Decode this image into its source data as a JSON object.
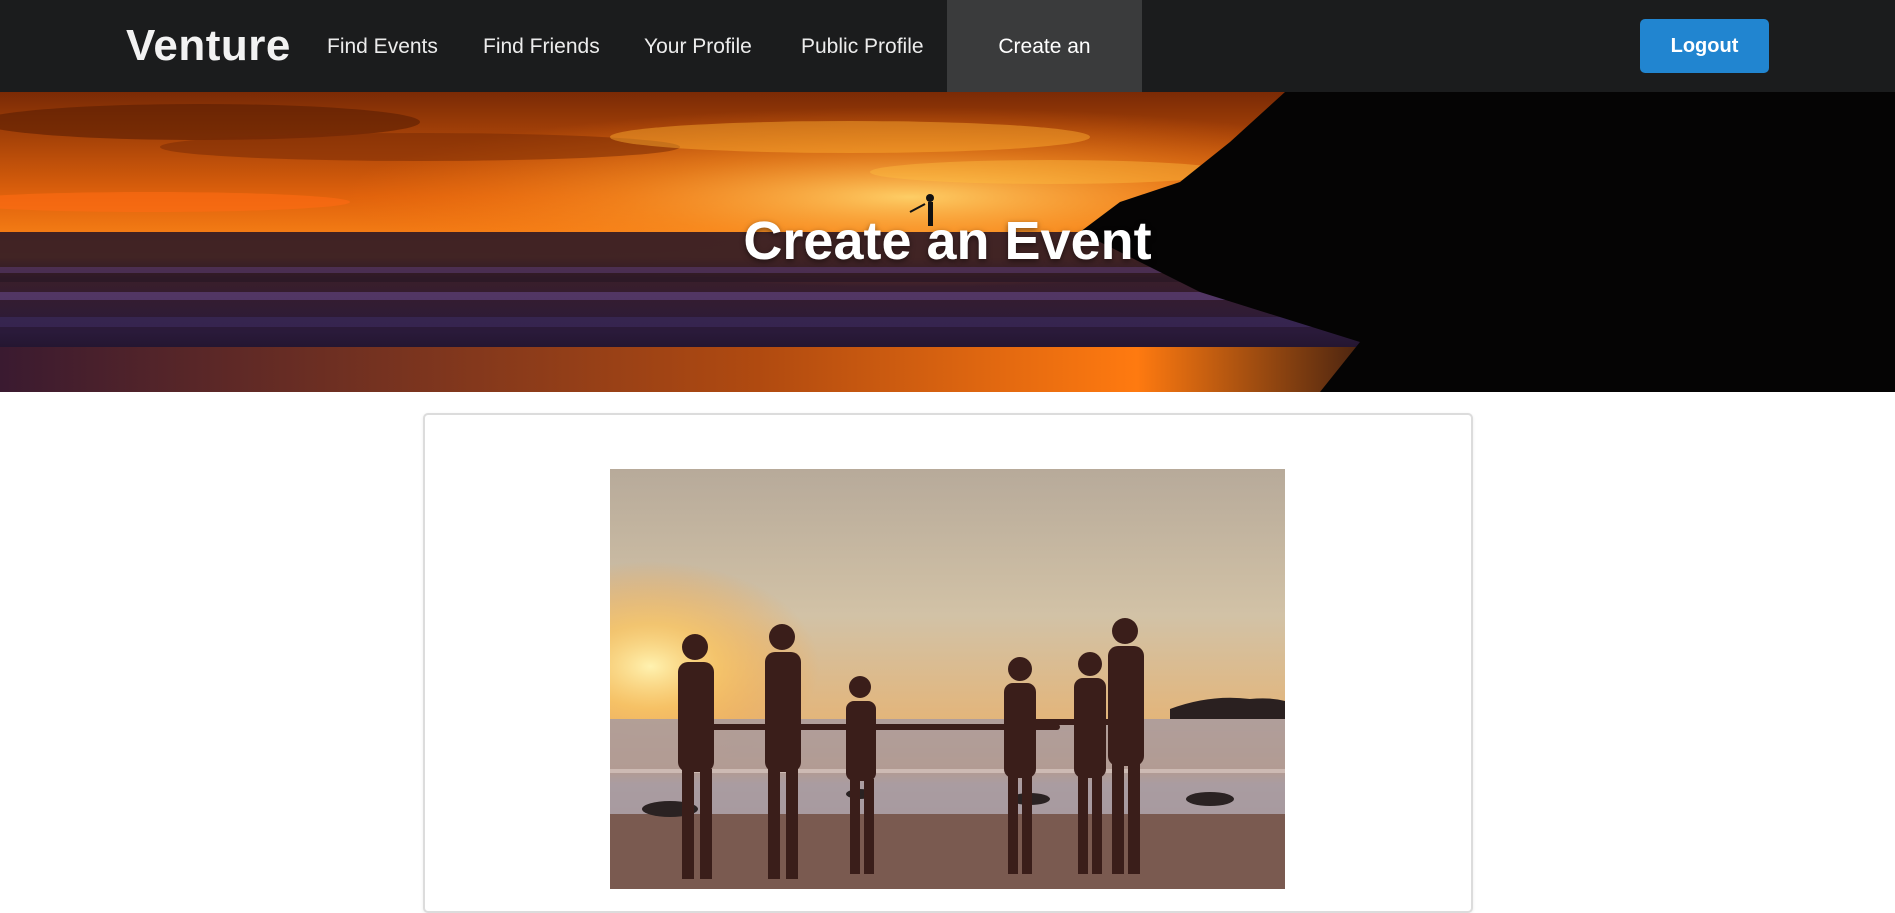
{
  "brand": "Venture",
  "nav": {
    "items": [
      {
        "label": "Find Events"
      },
      {
        "label": "Find Friends"
      },
      {
        "label": "Your Profile"
      },
      {
        "label": "Public Profile"
      },
      {
        "label": "Create an Event",
        "active": true
      }
    ],
    "logout_label": "Logout"
  },
  "hero": {
    "title": "Create an Event"
  },
  "colors": {
    "navbar": "#1b1c1d",
    "active_nav": "#3a3b3c",
    "primary_button": "#2185d0"
  }
}
